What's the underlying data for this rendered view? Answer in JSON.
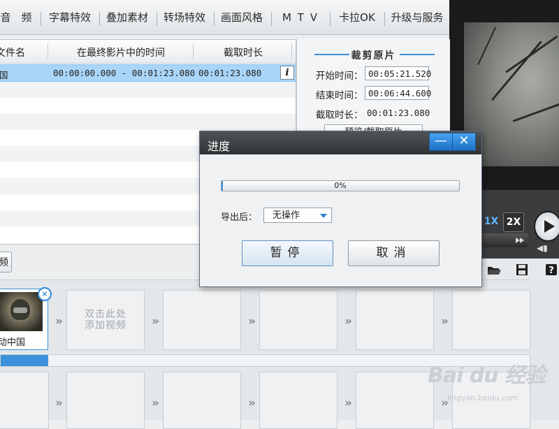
{
  "tabs": [
    {
      "name": "tab-audio",
      "label": "音　频"
    },
    {
      "name": "tab-subtitle",
      "label": "字幕特效"
    },
    {
      "name": "tab-overlay",
      "label": "叠加素材"
    },
    {
      "name": "tab-transition",
      "label": "转场特效"
    },
    {
      "name": "tab-style",
      "label": "画面风格"
    },
    {
      "name": "tab-mtv",
      "label": "M T V"
    },
    {
      "name": "tab-karaoke",
      "label": "卡拉OK"
    },
    {
      "name": "tab-upgrade",
      "label": "升级与服务"
    }
  ],
  "clip_table": {
    "headers": [
      "文件名",
      "在最终影片中的时间",
      "截取时长"
    ],
    "selected_row": {
      "name": "国",
      "time_range": "00:00:00.000 - 00:01:23.080",
      "duration": "00:01:23.080"
    },
    "info_icon": "i"
  },
  "trim": {
    "title": "裁剪原片",
    "start_label": "开始时间：",
    "start_value": "00:05:21.520",
    "end_label": "结束时间：",
    "end_value": "00:06:44.600",
    "duration_label": "截取时长：",
    "duration_value": "00:01:23.080",
    "preview_button": "预览/截取原片"
  },
  "left_button": "频",
  "player": {
    "speed_1x": "1X",
    "speed_2x": "2X"
  },
  "timeline": {
    "clip_name": "动中国",
    "clip_close": "×",
    "add_placeholder_line1": "双击此处",
    "add_placeholder_line2": "添加视频",
    "arrow_glyph": "»",
    "track_progress": 0.09
  },
  "toolbar_icons": [
    "folder-open-icon",
    "save-icon",
    "help-icon"
  ],
  "watermark": {
    "text": "Bai du 经验",
    "url": "jingyan.baidu.com"
  },
  "dialog": {
    "title": "进度",
    "minimize_glyph": "—",
    "close_glyph": "✕",
    "progress_text": "0%",
    "progress_value": 0,
    "export_after_label": "导出后：",
    "export_after_value": "无操作",
    "pause_button": "暂停",
    "cancel_button": "取消"
  },
  "colors": {
    "accent": "#3d91dc",
    "selection": "#a9d5f8",
    "title_bar": "#3a3d40"
  }
}
